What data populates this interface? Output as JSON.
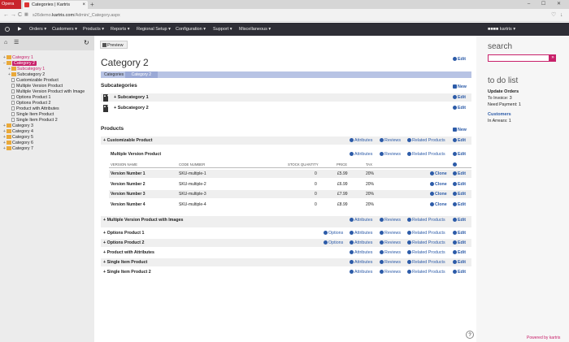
{
  "browser": {
    "opera": "Opera",
    "tab_title": "Categories | Kartris",
    "tab_close": "×",
    "new_tab": "+",
    "window_controls": "– ☐ ✕",
    "url_prefix": "s26demo.",
    "url_host": "kartris.com",
    "url_path": "/Admin/_Category.aspx"
  },
  "nav": {
    "items": [
      "Orders",
      "Customers",
      "Products",
      "Reports",
      "Regional Setup",
      "Configuration",
      "Support",
      "Miscellaneous"
    ],
    "user": "■■■■ kartris"
  },
  "tree": {
    "items": [
      {
        "label": "Category 1",
        "level": 0,
        "type": "folder",
        "toggle": "+",
        "style": "pink"
      },
      {
        "label": "Category 2",
        "level": 0,
        "type": "folder",
        "toggle": "–",
        "style": "selected"
      },
      {
        "label": "Subcategory 1",
        "level": 1,
        "type": "folder",
        "toggle": "+",
        "style": "pink"
      },
      {
        "label": "Subcategory 2",
        "level": 1,
        "type": "folder",
        "toggle": "+",
        "style": ""
      },
      {
        "label": "Customizable Product",
        "level": 1,
        "type": "page",
        "toggle": "",
        "style": ""
      },
      {
        "label": "Multiple Version Product",
        "level": 1,
        "type": "page",
        "toggle": "",
        "style": ""
      },
      {
        "label": "Multiple Version Product with Image",
        "level": 1,
        "type": "page",
        "toggle": "",
        "style": ""
      },
      {
        "label": "Options Product 1",
        "level": 1,
        "type": "page",
        "toggle": "",
        "style": ""
      },
      {
        "label": "Options Product 2",
        "level": 1,
        "type": "page",
        "toggle": "",
        "style": ""
      },
      {
        "label": "Product with Attributes",
        "level": 1,
        "type": "page",
        "toggle": "",
        "style": ""
      },
      {
        "label": "Single Item Product",
        "level": 1,
        "type": "page",
        "toggle": "",
        "style": ""
      },
      {
        "label": "Single Item Product 2",
        "level": 1,
        "type": "page",
        "toggle": "",
        "style": ""
      },
      {
        "label": "Category 3",
        "level": 0,
        "type": "folder",
        "toggle": "+",
        "style": ""
      },
      {
        "label": "Category 4",
        "level": 0,
        "type": "folder",
        "toggle": "+",
        "style": ""
      },
      {
        "label": "Category 5",
        "level": 0,
        "type": "folder",
        "toggle": "+",
        "style": ""
      },
      {
        "label": "Category 6",
        "level": 0,
        "type": "folder",
        "toggle": "+",
        "style": ""
      },
      {
        "label": "Category 7",
        "level": 0,
        "type": "folder",
        "toggle": "+",
        "style": ""
      }
    ]
  },
  "main": {
    "preview": "Preview",
    "title": "Category 2",
    "edit": "Edit",
    "crumb": [
      "Categories",
      "Category 2"
    ],
    "subcats_heading": "Subcategories",
    "new": "New",
    "subcats": [
      "Subcategory 1",
      "Subcategory 2"
    ],
    "products_heading": "Products",
    "actions": {
      "attributes": "Attributes",
      "reviews": "Reviews",
      "related": "Related Products",
      "edit": "Edit",
      "options": "Options",
      "clone": "Clone"
    },
    "customizable": "Customizable Product",
    "mv_title": "Multiple Version Product",
    "version_headers": [
      "VERSION NAME",
      "CODE NUMBER",
      "STOCK QUANTITY",
      "PRICE",
      "TAX"
    ],
    "versions": [
      {
        "name": "Version Number 1",
        "code": "SKU-multiple-1",
        "stock": "0",
        "price": "£5.99",
        "tax": "20%"
      },
      {
        "name": "Version Number 2",
        "code": "SKU-multiple-2",
        "stock": "0",
        "price": "£6.99",
        "tax": "20%"
      },
      {
        "name": "Version Number 3",
        "code": "SKU-multiple-3",
        "stock": "0",
        "price": "£7.99",
        "tax": "20%"
      },
      {
        "name": "Version Number 4",
        "code": "SKU-multiple-4",
        "stock": "0",
        "price": "£8.99",
        "tax": "20%"
      }
    ],
    "products": [
      {
        "name": "Multiple Version Product with Images",
        "options": false
      },
      {
        "name": "Options Product 1",
        "options": true
      },
      {
        "name": "Options Product 2",
        "options": true
      },
      {
        "name": "Product with Attributes",
        "options": false
      },
      {
        "name": "Single Item Product",
        "options": false
      },
      {
        "name": "Single Item Product 2",
        "options": false
      }
    ],
    "help": "?"
  },
  "right": {
    "search_heading": "search",
    "search_button": "»",
    "todo_heading": "to do list",
    "update_orders": "Update Orders",
    "to_invoice": "To Invoice: 3",
    "need_payment": "Need Payment: 1",
    "customers": "Customers",
    "in_arrears": "In Arrears: 1",
    "powered": "Powered by kartris"
  }
}
